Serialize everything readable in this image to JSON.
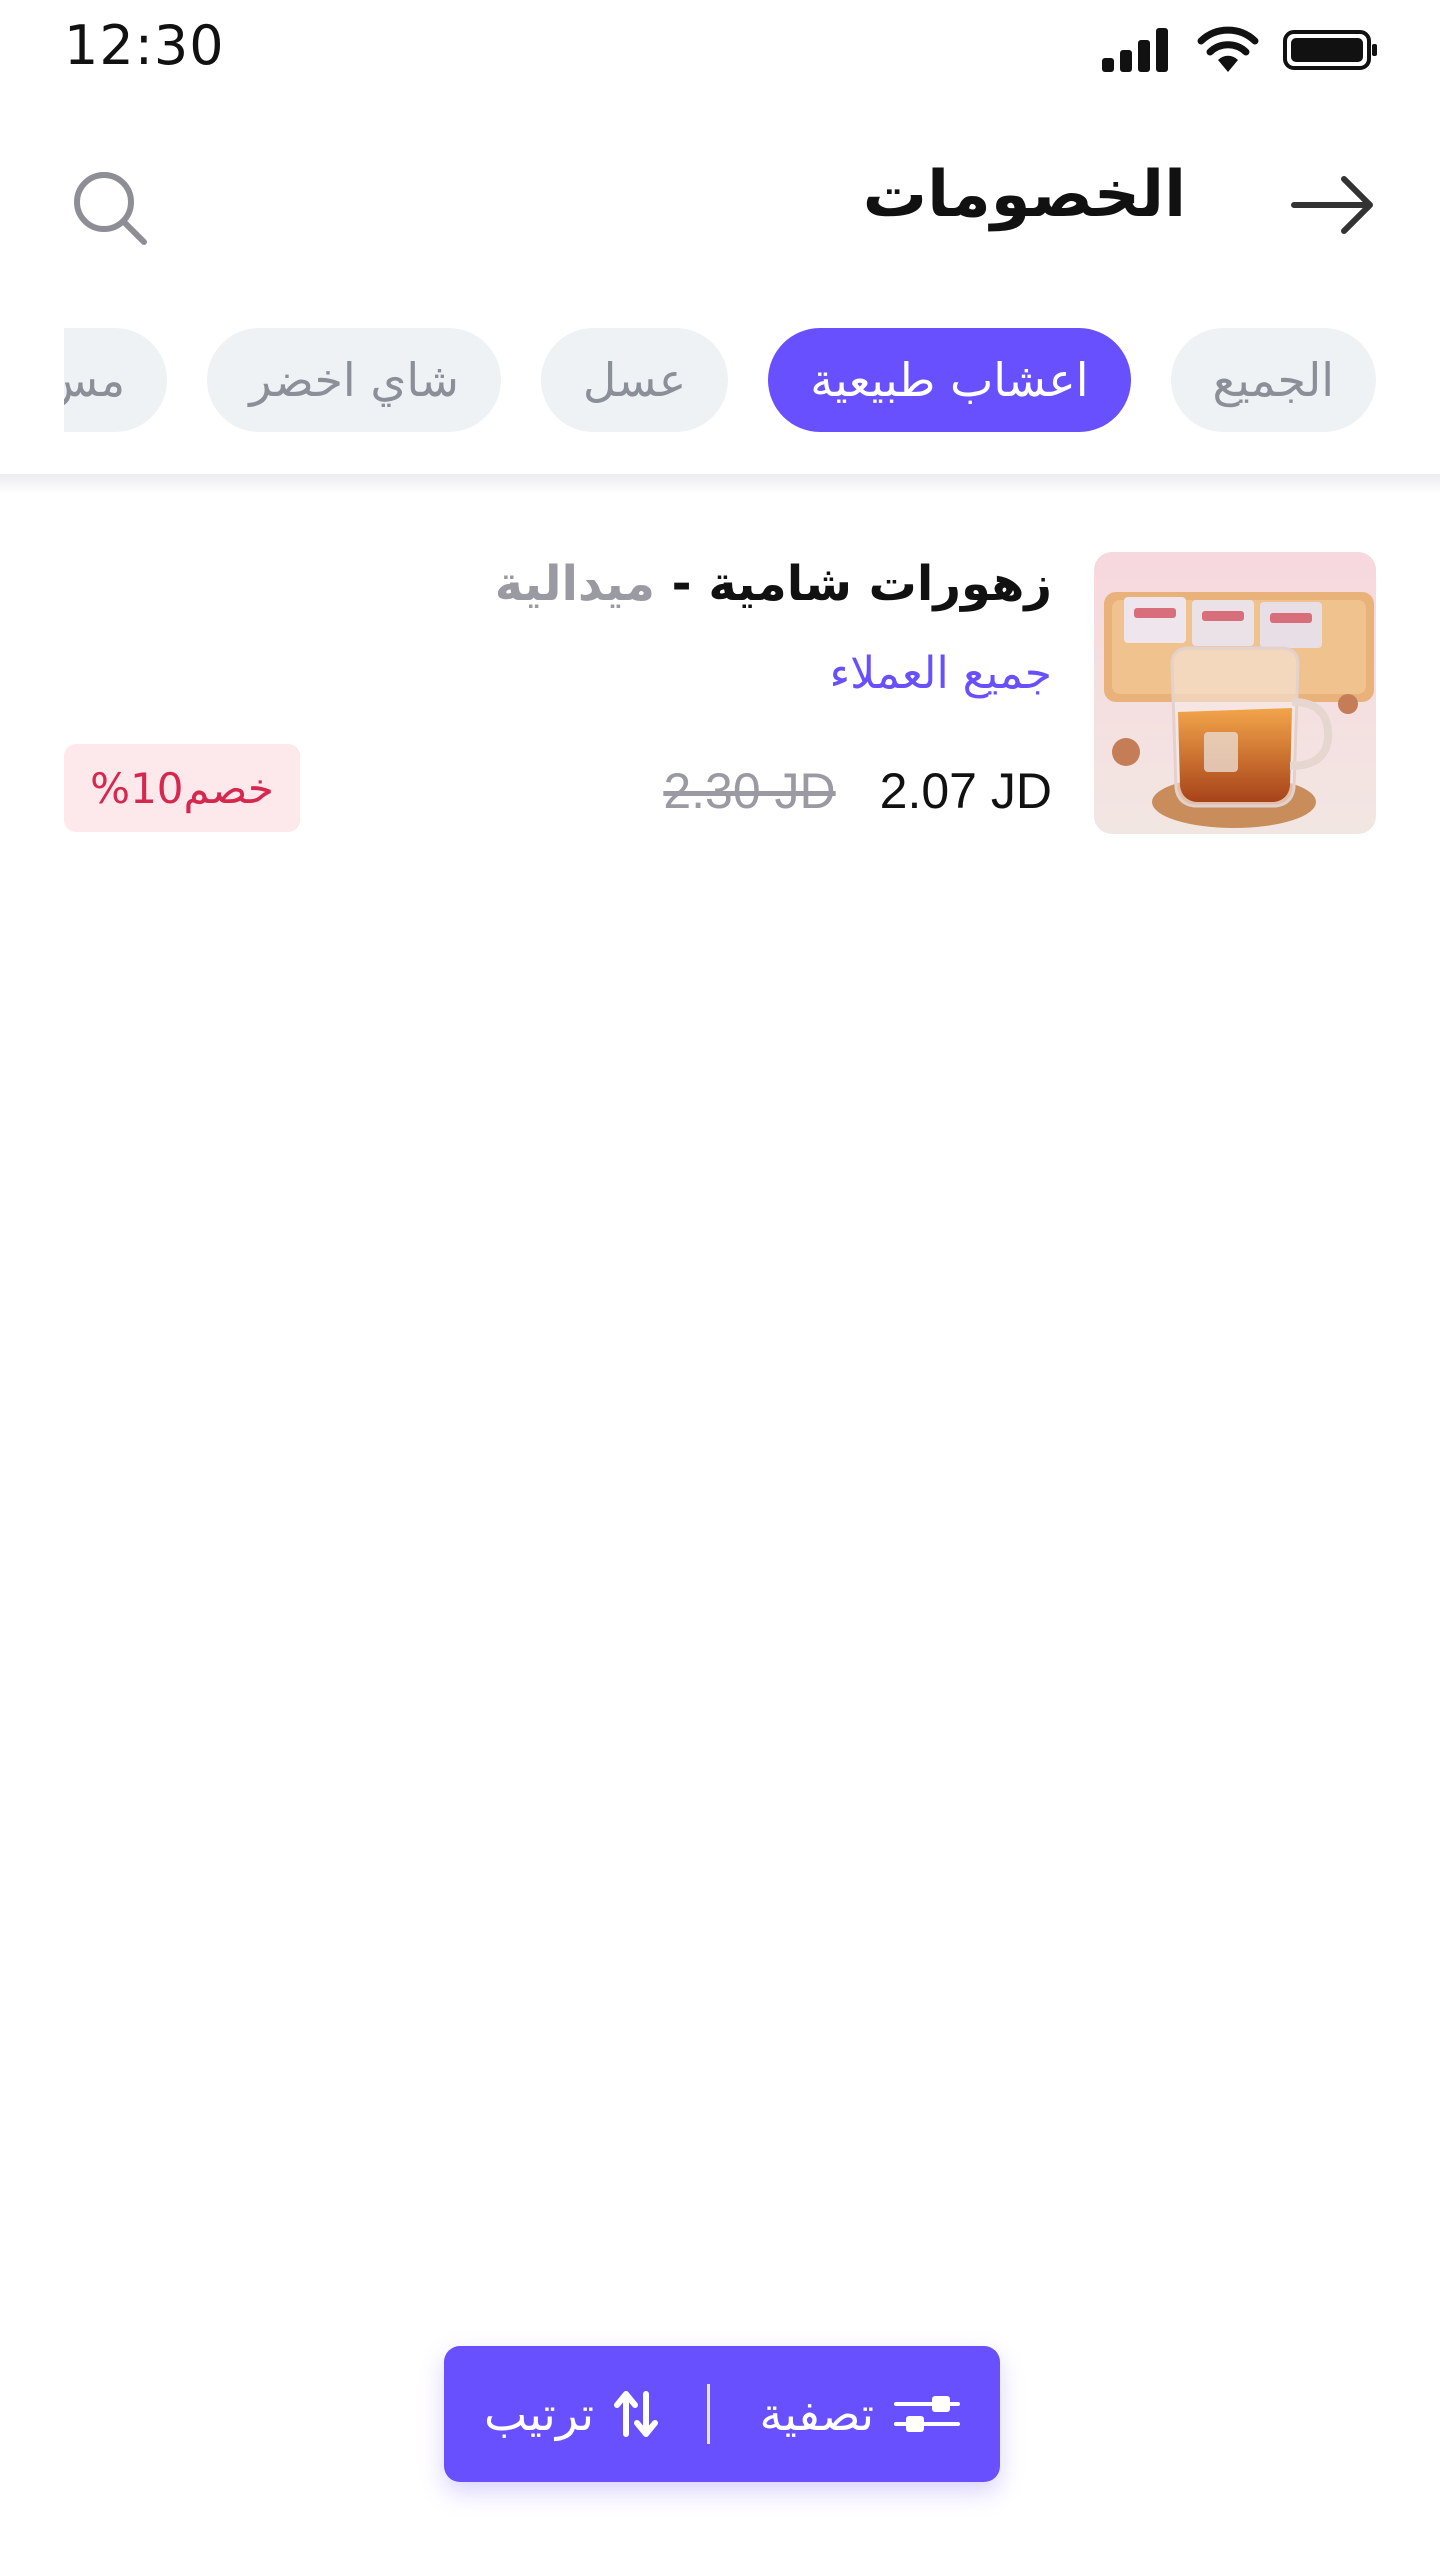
{
  "status_bar": {
    "time": "12:30"
  },
  "header": {
    "title": "الخصومات"
  },
  "chips": [
    {
      "label": "الجميع",
      "active": false
    },
    {
      "label": "اعشاب طبيعية",
      "active": true
    },
    {
      "label": "عسل",
      "active": false
    },
    {
      "label": "شاي اخضر",
      "active": false
    },
    {
      "label": "مس",
      "active": false
    }
  ],
  "product": {
    "name": "زهورات شامية",
    "separator": " - ",
    "brand": "ميدالية",
    "audience": "جميع العملاء",
    "price_current": "2.07 JD",
    "price_old": "2.30 JD",
    "discount": "خصم10%"
  },
  "actions": {
    "filter_label": "تصفية",
    "sort_label": "ترتيب"
  },
  "colors": {
    "accent": "#6850ff",
    "chip_bg": "#eff2f5",
    "discount_bg": "#fde8ec",
    "discount_text": "#d6284e"
  }
}
